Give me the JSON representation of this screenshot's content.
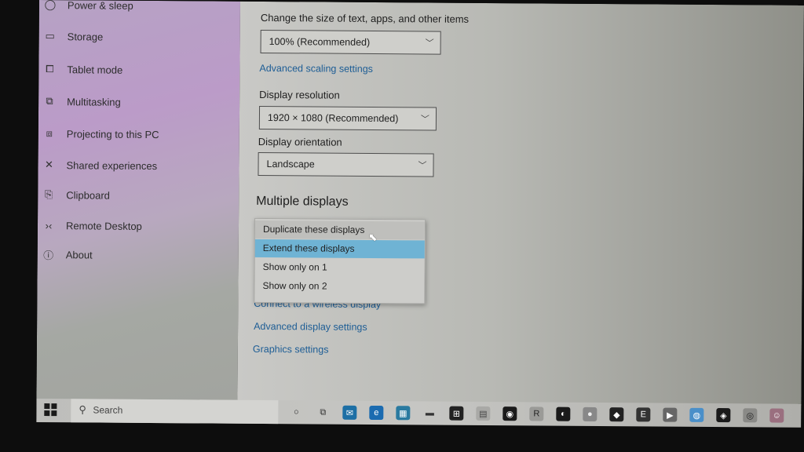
{
  "sidebar": {
    "items": [
      {
        "label": "Power & sleep",
        "icon": "power-icon"
      },
      {
        "label": "Storage",
        "icon": "storage-icon"
      },
      {
        "label": "Tablet mode",
        "icon": "tablet-mode-icon"
      },
      {
        "label": "Multitasking",
        "icon": "multitasking-icon"
      },
      {
        "label": "Projecting to this PC",
        "icon": "projecting-icon"
      },
      {
        "label": "Shared experiences",
        "icon": "shared-experiences-icon"
      },
      {
        "label": "Clipboard",
        "icon": "clipboard-icon"
      },
      {
        "label": "Remote Desktop",
        "icon": "remote-desktop-icon"
      },
      {
        "label": "About",
        "icon": "info-icon"
      }
    ]
  },
  "main": {
    "scale_label": "Change the size of text, apps, and other items",
    "scale_value": "100% (Recommended)",
    "advanced_scaling_link": "Advanced scaling settings",
    "resolution_label": "Display resolution",
    "resolution_value": "1920 × 1080 (Recommended)",
    "orientation_label": "Display orientation",
    "orientation_value": "Landscape",
    "multiple_displays_heading": "Multiple displays",
    "multiple_displays_options": [
      "Duplicate these displays",
      "Extend these displays",
      "Show only on 1",
      "Show only on 2"
    ],
    "multiple_displays_selected": "Extend these displays",
    "multiple_displays_hovered": "Duplicate these displays",
    "links": [
      "Connect to a wireless display",
      "Advanced display settings",
      "Graphics settings"
    ]
  },
  "taskbar": {
    "search_placeholder": "Search",
    "pinned": [
      {
        "name": "cortana-icon",
        "glyph": "○"
      },
      {
        "name": "task-view-icon",
        "glyph": "⧉"
      },
      {
        "name": "mail-icon",
        "glyph": "✉"
      },
      {
        "name": "edge-icon",
        "glyph": "e"
      },
      {
        "name": "calendar-app-icon",
        "glyph": "▦"
      },
      {
        "name": "file-explorer-icon",
        "glyph": "▬"
      },
      {
        "name": "store-icon",
        "glyph": "⊞"
      },
      {
        "name": "notes-app-icon",
        "glyph": "▤"
      },
      {
        "name": "media-player-icon",
        "glyph": "◉"
      },
      {
        "name": "rockstar-launcher-icon",
        "glyph": "R"
      },
      {
        "name": "steam-icon",
        "glyph": "◐"
      },
      {
        "name": "origin-icon",
        "glyph": "●"
      },
      {
        "name": "game-app-icon",
        "glyph": "◆"
      },
      {
        "name": "epic-games-icon",
        "glyph": "E"
      },
      {
        "name": "video-app-icon",
        "glyph": "▶"
      },
      {
        "name": "chrome-icon",
        "glyph": "◍"
      },
      {
        "name": "gamepad-icon",
        "glyph": "◈"
      },
      {
        "name": "camera-icon",
        "glyph": "◎"
      },
      {
        "name": "user-app-icon",
        "glyph": "☺"
      }
    ]
  }
}
